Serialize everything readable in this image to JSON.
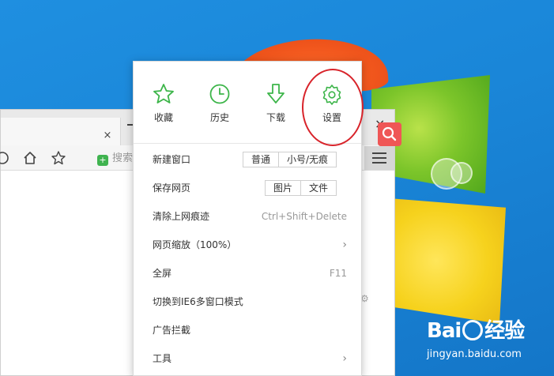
{
  "browser": {
    "tab_close": "×",
    "window_close": "×",
    "search_placeholder": "搜索"
  },
  "menu": {
    "tools": [
      {
        "label": "收藏",
        "icon": "star-icon"
      },
      {
        "label": "历史",
        "icon": "clock-icon"
      },
      {
        "label": "下载",
        "icon": "download-icon"
      },
      {
        "label": "设置",
        "icon": "gear-icon"
      }
    ],
    "items": [
      {
        "label": "新建窗口",
        "buttons": [
          "普通",
          "小号/无痕"
        ]
      },
      {
        "label": "保存网页",
        "buttons": [
          "图片",
          "文件"
        ]
      },
      {
        "label": "清除上网痕迹",
        "shortcut": "Ctrl+Shift+Delete"
      },
      {
        "label": "网页缩放（100%）",
        "has_submenu": true
      },
      {
        "label": "全屏",
        "shortcut": "F11"
      },
      {
        "label": "切换到IE6多窗口模式"
      },
      {
        "label": "广告拦截"
      },
      {
        "label": "工具",
        "has_submenu": true
      }
    ],
    "accent_color": "#3db54a",
    "highlight_color": "#d8232a"
  },
  "watermark": {
    "brand_left": "Bai",
    "brand_right": "经验",
    "domain": "jingyan.baidu.com"
  }
}
